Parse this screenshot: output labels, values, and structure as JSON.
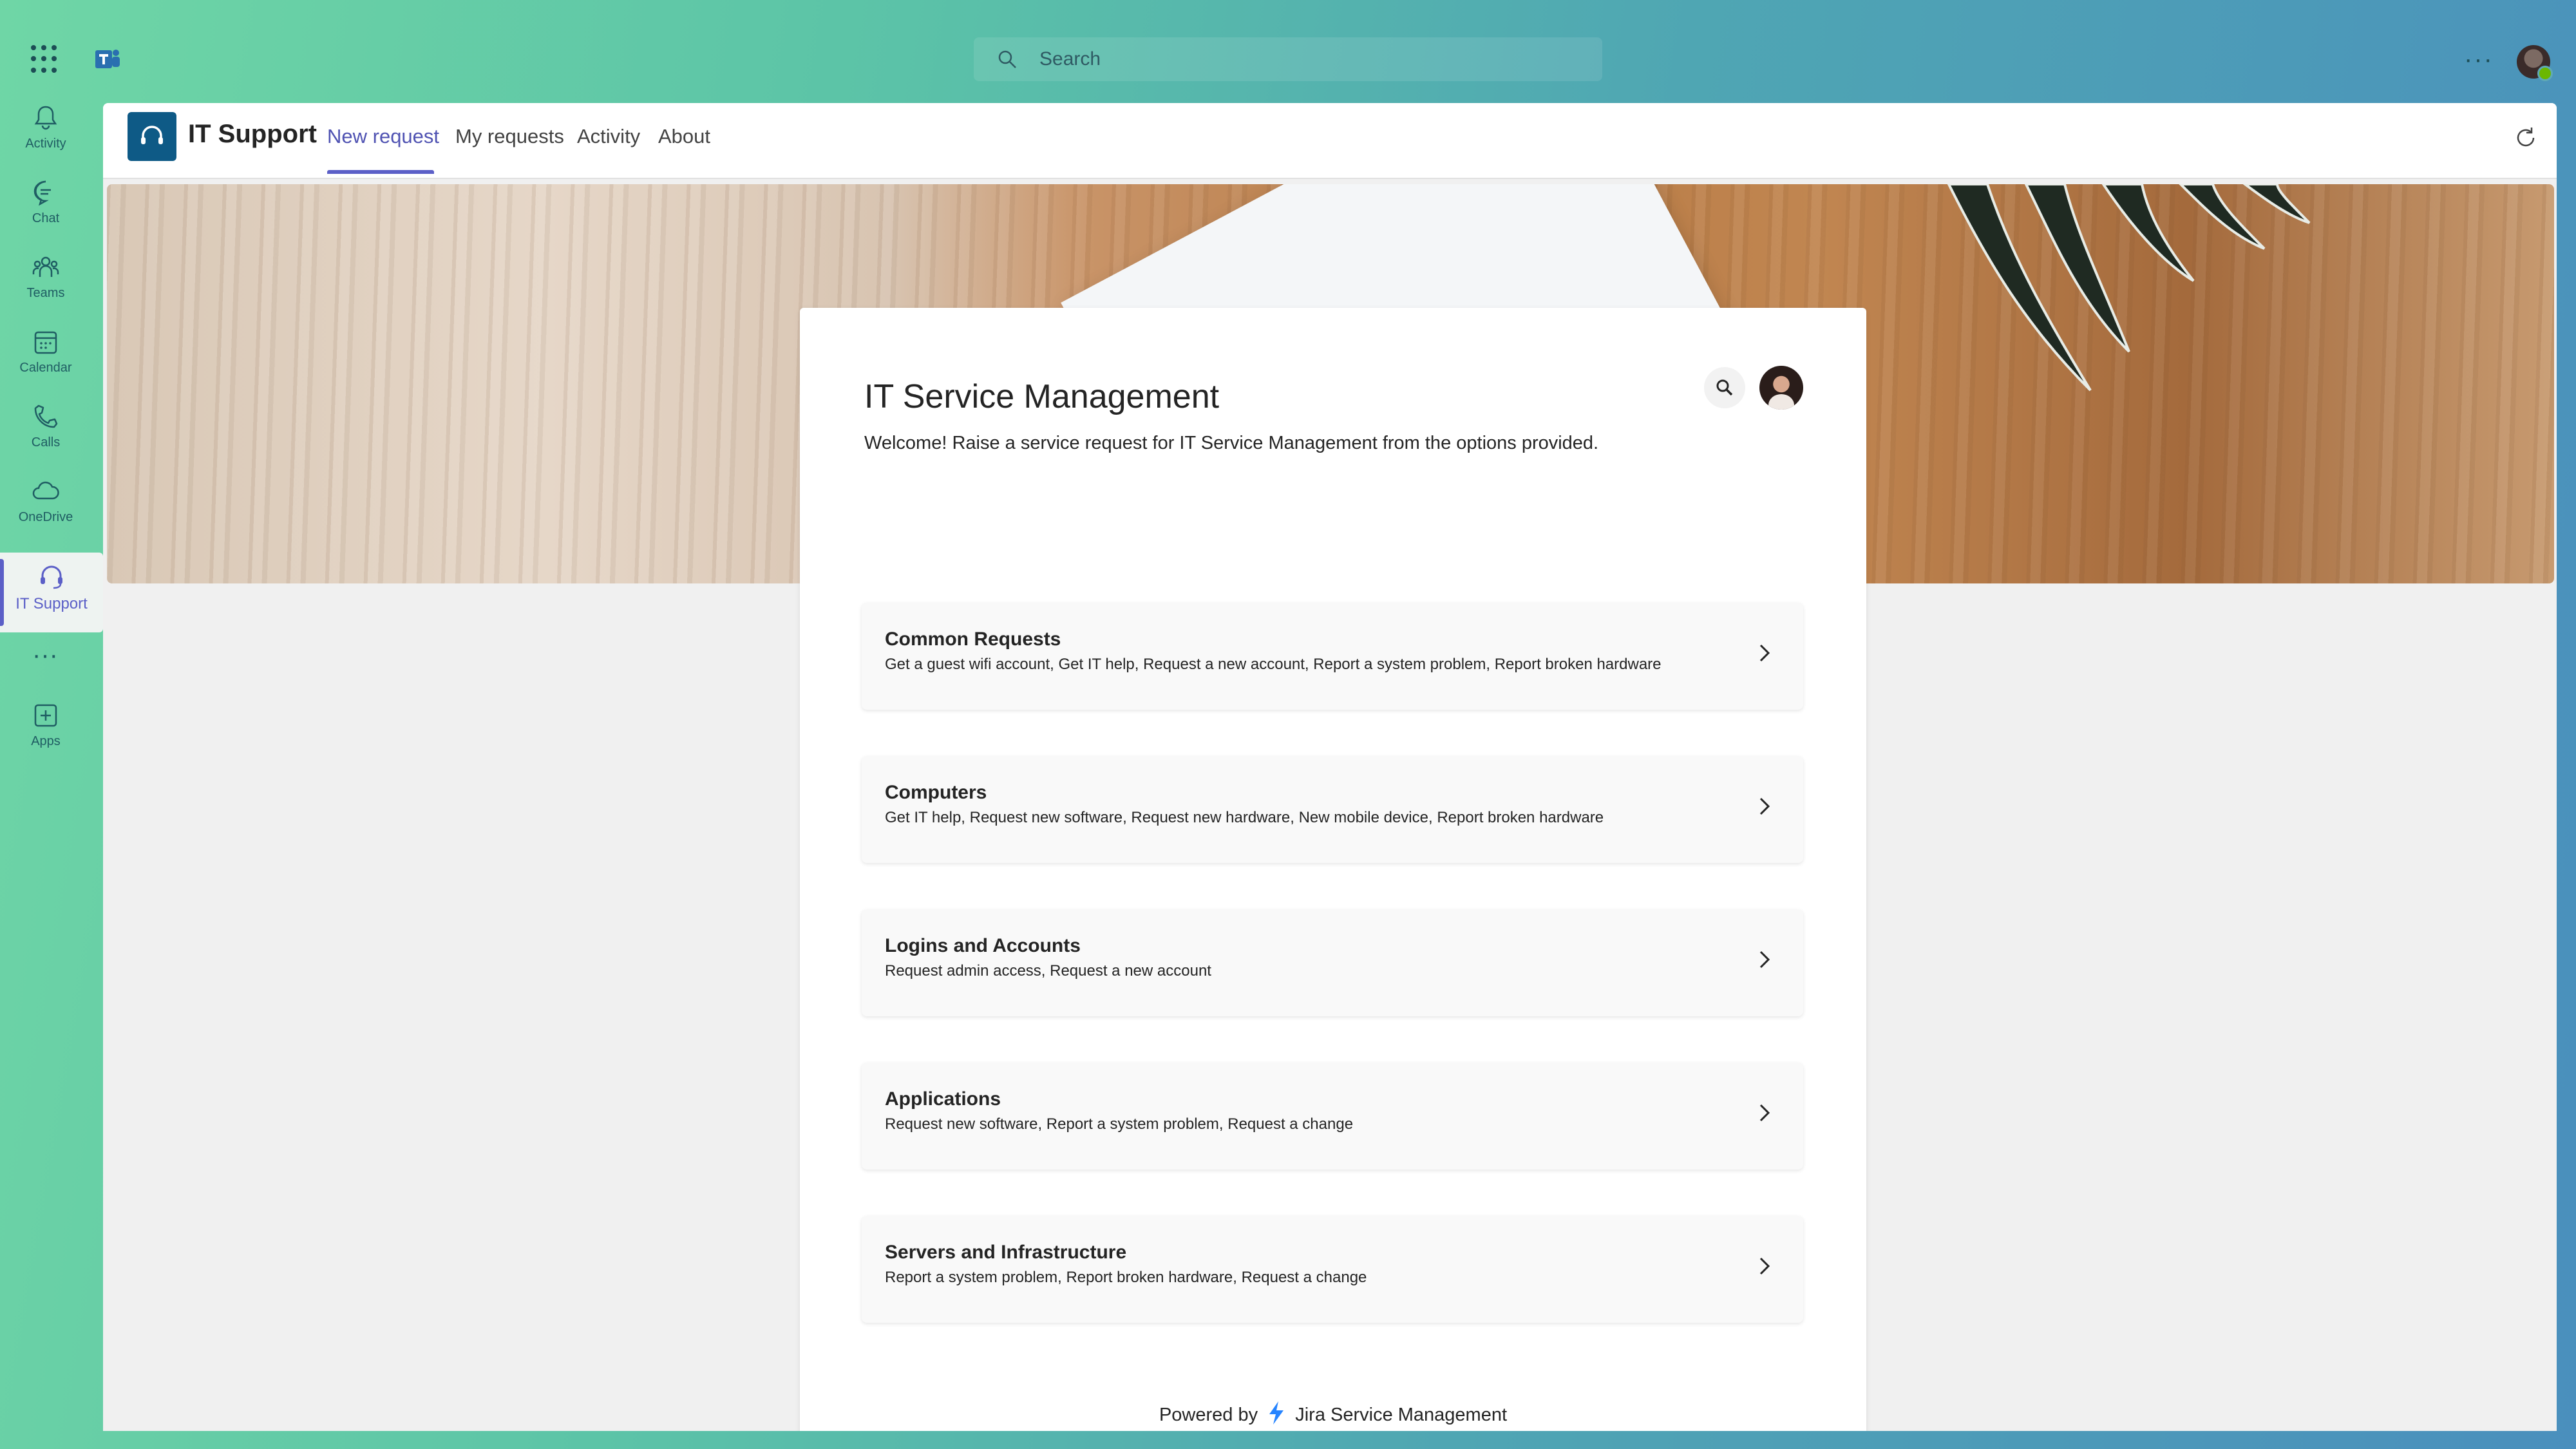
{
  "topbar": {
    "search_placeholder": "Search",
    "more_label": "···",
    "icons": [
      "app-launcher-icon",
      "teams-logo-icon",
      "search-icon",
      "more-icon",
      "avatar"
    ]
  },
  "rail": {
    "items": [
      {
        "label": "Activity",
        "icon": "bell-icon"
      },
      {
        "label": "Chat",
        "icon": "chat-icon"
      },
      {
        "label": "Teams",
        "icon": "teams-icon"
      },
      {
        "label": "Calendar",
        "icon": "calendar-icon"
      },
      {
        "label": "Calls",
        "icon": "phone-icon"
      },
      {
        "label": "OneDrive",
        "icon": "cloud-icon"
      },
      {
        "label": "IT Support",
        "icon": "headset-icon",
        "active": true
      },
      {
        "label": "Apps",
        "icon": "add-app-icon"
      }
    ],
    "more_label": "···"
  },
  "app": {
    "title": "IT Support",
    "tabs": [
      {
        "label": "New request",
        "active": true
      },
      {
        "label": "My requests"
      },
      {
        "label": "Activity"
      },
      {
        "label": "About"
      }
    ]
  },
  "portal": {
    "title": "IT Service Management",
    "welcome": "Welcome! Raise a service request for IT Service Management from the options provided.",
    "requests": [
      {
        "title": "Common Requests",
        "description": "Get a guest wifi account, Get IT help, Request a new account, Report a system problem, Report broken hardware"
      },
      {
        "title": "Computers",
        "description": "Get IT help, Request new software, Request new hardware, New mobile device, Report broken hardware"
      },
      {
        "title": "Logins and Accounts",
        "description": "Request admin access, Request a new account"
      },
      {
        "title": "Applications",
        "description": "Request new software, Report a system problem, Request a change"
      },
      {
        "title": "Servers and Infrastructure",
        "description": "Report a system problem, Report broken hardware, Request a change"
      }
    ],
    "powered_by": "Powered by",
    "powered_product": "Jira Service Management"
  },
  "colors": {
    "accent": "#5b5fc7",
    "app_logo": "#0e5a86",
    "jira_blue": "#2684ff"
  }
}
